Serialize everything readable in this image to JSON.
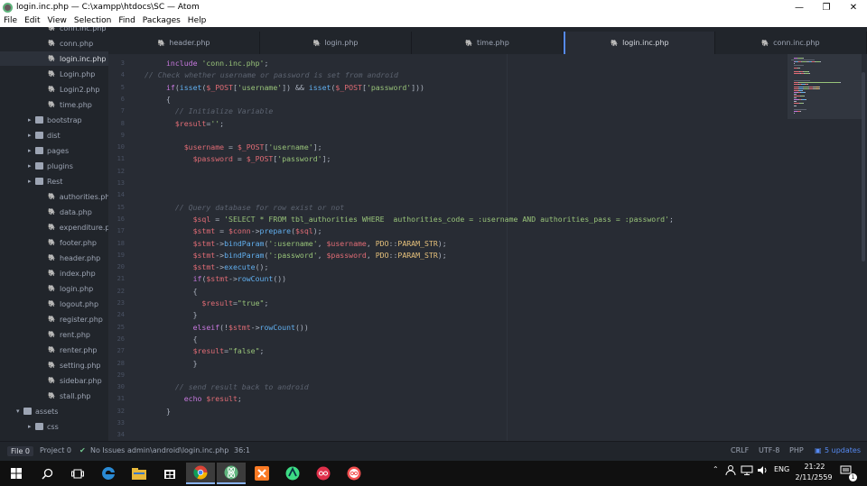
{
  "titlebar": {
    "title": "login.inc.php — C:\\xampp\\htdocs\\SC — Atom",
    "minimize": "—",
    "maximize": "❐",
    "close": "✕"
  },
  "menu": [
    "File",
    "Edit",
    "View",
    "Selection",
    "Find",
    "Packages",
    "Help"
  ],
  "tree": {
    "items": [
      {
        "label": "conn.inc.php",
        "type": "file"
      },
      {
        "label": "conn.php",
        "type": "file"
      },
      {
        "label": "login.inc.php",
        "type": "file",
        "selected": true
      },
      {
        "label": "Login.php",
        "type": "file"
      },
      {
        "label": "Login2.php",
        "type": "file"
      },
      {
        "label": "time.php",
        "type": "file"
      },
      {
        "label": "bootstrap",
        "type": "folder"
      },
      {
        "label": "dist",
        "type": "folder"
      },
      {
        "label": "pages",
        "type": "folder"
      },
      {
        "label": "plugins",
        "type": "folder"
      },
      {
        "label": "Rest",
        "type": "folder"
      },
      {
        "label": "authorities.php",
        "type": "file"
      },
      {
        "label": "data.php",
        "type": "file"
      },
      {
        "label": "expenditure.php",
        "type": "file"
      },
      {
        "label": "footer.php",
        "type": "file"
      },
      {
        "label": "header.php",
        "type": "file"
      },
      {
        "label": "index.php",
        "type": "file"
      },
      {
        "label": "login.php",
        "type": "file"
      },
      {
        "label": "logout.php",
        "type": "file"
      },
      {
        "label": "register.php",
        "type": "file"
      },
      {
        "label": "rent.php",
        "type": "file"
      },
      {
        "label": "renter.php",
        "type": "file"
      },
      {
        "label": "setting.php",
        "type": "file"
      },
      {
        "label": "sidebar.php",
        "type": "file"
      },
      {
        "label": "stall.php",
        "type": "file"
      },
      {
        "label": "assets",
        "type": "folder-open"
      },
      {
        "label": "css",
        "type": "folder"
      }
    ]
  },
  "tabs": [
    {
      "label": "header.php",
      "active": false
    },
    {
      "label": "login.php",
      "active": false
    },
    {
      "label": "time.php",
      "active": false
    },
    {
      "label": "login.inc.php",
      "active": true
    },
    {
      "label": "conn.inc.php",
      "active": false
    }
  ],
  "editor": {
    "lines": [
      {
        "n": "3",
        "indent": 1,
        "tokens": [
          [
            "kw",
            "include "
          ],
          [
            "str",
            "'conn.inc.php'"
          ],
          [
            "plain",
            ";"
          ]
        ]
      },
      {
        "n": "4",
        "indent": 0,
        "tokens": [
          [
            "cmt",
            "// Check whether username or password is set from android"
          ]
        ]
      },
      {
        "n": "5",
        "indent": 1,
        "tokens": [
          [
            "kw",
            "if"
          ],
          [
            "plain",
            "("
          ],
          [
            "fn",
            "isset"
          ],
          [
            "plain",
            "("
          ],
          [
            "var",
            "$_POST"
          ],
          [
            "plain",
            "["
          ],
          [
            "str",
            "'username'"
          ],
          [
            "plain",
            "]) && "
          ],
          [
            "fn",
            "isset"
          ],
          [
            "plain",
            "("
          ],
          [
            "var",
            "$_POST"
          ],
          [
            "plain",
            "["
          ],
          [
            "str",
            "'password'"
          ],
          [
            "plain",
            "]))"
          ]
        ]
      },
      {
        "n": "6",
        "indent": 1,
        "tokens": [
          [
            "plain",
            "{"
          ]
        ]
      },
      {
        "n": "7",
        "indent": 1,
        "tokens": [
          [
            "cmt",
            "  // Initialize Variable"
          ]
        ]
      },
      {
        "n": "8",
        "indent": 1,
        "tokens": [
          [
            "var",
            "  $result"
          ],
          [
            "plain",
            "="
          ],
          [
            "str",
            "''"
          ],
          [
            "plain",
            ";"
          ]
        ]
      },
      {
        "n": "9",
        "indent": 0,
        "tokens": []
      },
      {
        "n": "10",
        "indent": 1,
        "tokens": [
          [
            "var",
            "    $username"
          ],
          [
            "plain",
            " = "
          ],
          [
            "var",
            "$_POST"
          ],
          [
            "plain",
            "["
          ],
          [
            "str",
            "'username'"
          ],
          [
            "plain",
            "];"
          ]
        ]
      },
      {
        "n": "11",
        "indent": 1,
        "tokens": [
          [
            "var",
            "      $password"
          ],
          [
            "plain",
            " = "
          ],
          [
            "var",
            "$_POST"
          ],
          [
            "plain",
            "["
          ],
          [
            "str",
            "'password'"
          ],
          [
            "plain",
            "];"
          ]
        ]
      },
      {
        "n": "12",
        "indent": 0,
        "tokens": []
      },
      {
        "n": "13",
        "indent": 0,
        "tokens": []
      },
      {
        "n": "14",
        "indent": 0,
        "tokens": []
      },
      {
        "n": "15",
        "indent": 1,
        "tokens": [
          [
            "cmt",
            "  // Query database for row exist or not"
          ]
        ]
      },
      {
        "n": "16",
        "indent": 1,
        "tokens": [
          [
            "var",
            "      $sql"
          ],
          [
            "plain",
            " = "
          ],
          [
            "str",
            "'SELECT * FROM tbl_authorities WHERE  authorities_code = :username AND authorities_pass = :password'"
          ],
          [
            "plain",
            ";"
          ]
        ]
      },
      {
        "n": "17",
        "indent": 1,
        "tokens": [
          [
            "var",
            "      $stmt"
          ],
          [
            "plain",
            " = "
          ],
          [
            "var",
            "$conn"
          ],
          [
            "plain",
            "->"
          ],
          [
            "fn",
            "prepare"
          ],
          [
            "plain",
            "("
          ],
          [
            "var",
            "$sql"
          ],
          [
            "plain",
            ");"
          ]
        ]
      },
      {
        "n": "18",
        "indent": 1,
        "tokens": [
          [
            "var",
            "      $stmt"
          ],
          [
            "plain",
            "->"
          ],
          [
            "fn",
            "bindParam"
          ],
          [
            "plain",
            "("
          ],
          [
            "str",
            "':username'"
          ],
          [
            "plain",
            ", "
          ],
          [
            "var",
            "$username"
          ],
          [
            "plain",
            ", "
          ],
          [
            "cls",
            "PDO"
          ],
          [
            "plain",
            "::"
          ],
          [
            "cls",
            "PARAM_STR"
          ],
          [
            "plain",
            ");"
          ]
        ]
      },
      {
        "n": "19",
        "indent": 1,
        "tokens": [
          [
            "var",
            "      $stmt"
          ],
          [
            "plain",
            "->"
          ],
          [
            "fn",
            "bindParam"
          ],
          [
            "plain",
            "("
          ],
          [
            "str",
            "':password'"
          ],
          [
            "plain",
            ", "
          ],
          [
            "var",
            "$password"
          ],
          [
            "plain",
            ", "
          ],
          [
            "cls",
            "PDO"
          ],
          [
            "plain",
            "::"
          ],
          [
            "cls",
            "PARAM_STR"
          ],
          [
            "plain",
            ");"
          ]
        ]
      },
      {
        "n": "20",
        "indent": 1,
        "tokens": [
          [
            "var",
            "      $stmt"
          ],
          [
            "plain",
            "->"
          ],
          [
            "fn",
            "execute"
          ],
          [
            "plain",
            "();"
          ]
        ]
      },
      {
        "n": "21",
        "indent": 1,
        "tokens": [
          [
            "kw",
            "      if"
          ],
          [
            "plain",
            "("
          ],
          [
            "var",
            "$stmt"
          ],
          [
            "plain",
            "->"
          ],
          [
            "fn",
            "rowCount"
          ],
          [
            "plain",
            "())"
          ]
        ]
      },
      {
        "n": "22",
        "indent": 1,
        "tokens": [
          [
            "plain",
            "      {"
          ]
        ]
      },
      {
        "n": "23",
        "indent": 1,
        "tokens": [
          [
            "var",
            "        $result"
          ],
          [
            "plain",
            "="
          ],
          [
            "str",
            "\"true\""
          ],
          [
            "plain",
            ";"
          ]
        ]
      },
      {
        "n": "24",
        "indent": 1,
        "tokens": [
          [
            "plain",
            "      }"
          ]
        ]
      },
      {
        "n": "25",
        "indent": 1,
        "tokens": [
          [
            "kw",
            "      elseif"
          ],
          [
            "plain",
            "(!"
          ],
          [
            "var",
            "$stmt"
          ],
          [
            "plain",
            "->"
          ],
          [
            "fn",
            "rowCount"
          ],
          [
            "plain",
            "())"
          ]
        ]
      },
      {
        "n": "26",
        "indent": 1,
        "tokens": [
          [
            "plain",
            "      {"
          ]
        ]
      },
      {
        "n": "27",
        "indent": 1,
        "tokens": [
          [
            "var",
            "      $result"
          ],
          [
            "plain",
            "="
          ],
          [
            "str",
            "\"false\""
          ],
          [
            "plain",
            ";"
          ]
        ]
      },
      {
        "n": "28",
        "indent": 1,
        "tokens": [
          [
            "plain",
            "      }"
          ]
        ]
      },
      {
        "n": "29",
        "indent": 0,
        "tokens": []
      },
      {
        "n": "30",
        "indent": 1,
        "tokens": [
          [
            "cmt",
            "  // send result back to android"
          ]
        ]
      },
      {
        "n": "31",
        "indent": 1,
        "tokens": [
          [
            "kw",
            "    echo "
          ],
          [
            "var",
            "$result"
          ],
          [
            "plain",
            ";"
          ]
        ]
      },
      {
        "n": "32",
        "indent": 1,
        "tokens": [
          [
            "plain",
            "}"
          ]
        ]
      },
      {
        "n": "33",
        "indent": 0,
        "tokens": []
      },
      {
        "n": "34",
        "indent": 0,
        "tokens": []
      }
    ]
  },
  "status": {
    "file_count": "File 0",
    "project_count": "Project 0",
    "issues": "No Issues",
    "path": "admin\\android\\login.inc.php",
    "cursor": "36:1",
    "line_ending": "CRLF",
    "encoding": "UTF-8",
    "grammar": "PHP",
    "updates": "5 updates"
  },
  "taskbar": {
    "language": "ENG",
    "time": "21:22",
    "date": "2/11/2559",
    "notifications": "1"
  },
  "colors": {
    "accent": "#568af2",
    "editor_bg": "#282c34",
    "panel_bg": "#21252b"
  }
}
